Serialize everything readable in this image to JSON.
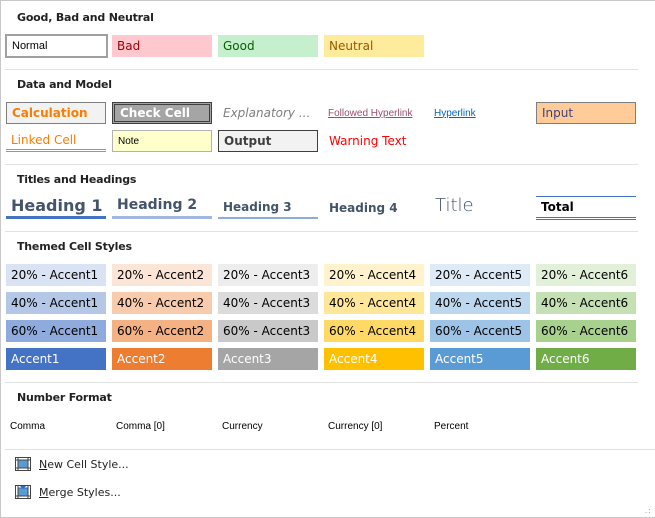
{
  "sections": {
    "good_bad_neutral": {
      "title": "Good, Bad and Neutral",
      "items": [
        "Normal",
        "Bad",
        "Good",
        "Neutral"
      ]
    },
    "data_model": {
      "title": "Data and Model",
      "row1": [
        "Calculation",
        "Check Cell",
        "Explanatory ...",
        "Followed Hyperlink",
        "Hyperlink",
        "Input"
      ],
      "row2": [
        "Linked Cell",
        "Note",
        "Output",
        "Warning Text"
      ]
    },
    "titles_headings": {
      "title": "Titles and Headings",
      "items": [
        "Heading 1",
        "Heading 2",
        "Heading 3",
        "Heading 4",
        "Title",
        "Total"
      ]
    },
    "themed": {
      "title": "Themed Cell Styles",
      "rows": [
        [
          "20% - Accent1",
          "20% - Accent2",
          "20% - Accent3",
          "20% - Accent4",
          "20% - Accent5",
          "20% - Accent6"
        ],
        [
          "40% - Accent1",
          "40% - Accent2",
          "40% - Accent3",
          "40% - Accent4",
          "40% - Accent5",
          "40% - Accent6"
        ],
        [
          "60% - Accent1",
          "60% - Accent2",
          "60% - Accent3",
          "60% - Accent4",
          "60% - Accent5",
          "60% - Accent6"
        ],
        [
          "Accent1",
          "Accent2",
          "Accent3",
          "Accent4",
          "Accent5",
          "Accent6"
        ]
      ],
      "colors": [
        [
          "#dae3f3",
          "#fbe5d6",
          "#ededed",
          "#fff2cc",
          "#deebf7",
          "#e2f0d9"
        ],
        [
          "#b4c7e7",
          "#f8cbad",
          "#dbdbdb",
          "#ffe699",
          "#bdd7ee",
          "#c5e0b4"
        ],
        [
          "#8faadc",
          "#f4b183",
          "#c9c9c9",
          "#ffd966",
          "#9dc3e6",
          "#a9d18e"
        ],
        [
          "#4472c4",
          "#ed7d31",
          "#a5a5a5",
          "#ffc000",
          "#5b9bd5",
          "#70ad47"
        ]
      ]
    },
    "number_format": {
      "title": "Number Format",
      "items": [
        "Comma",
        "Comma [0]",
        "Currency",
        "Currency [0]",
        "Percent"
      ]
    }
  },
  "actions": {
    "new_cell_style": {
      "mnemonic": "N",
      "rest": "ew Cell Style...",
      "icon": "new-cell-style-icon"
    },
    "merge_styles": {
      "mnemonic": "M",
      "rest": "erge Styles...",
      "icon": "merge-styles-icon"
    }
  }
}
